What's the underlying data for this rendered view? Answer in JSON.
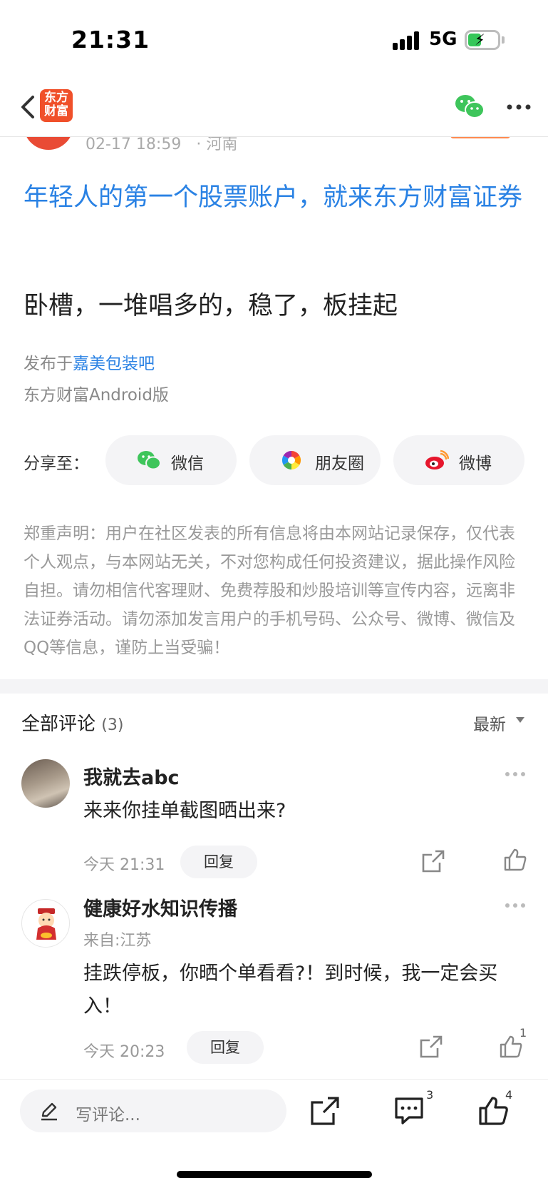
{
  "status_bar": {
    "time": "21:31",
    "network": "5G"
  },
  "nav": {
    "logo_line1": "东方",
    "logo_line2": "财富"
  },
  "post": {
    "meta_time": "02-17 18:59",
    "meta_location": "· 河南",
    "title": "年轻人的第一个股票账户，就来东方财富证券",
    "body": "卧槽，一堆唱多的，稳了，板挂起",
    "published_prefix": "发布于",
    "published_bar": "嘉美包装吧",
    "platform": "东方财富Android版"
  },
  "share": {
    "label": "分享至：",
    "buttons": [
      {
        "label": "微信",
        "icon": "wechat-icon"
      },
      {
        "label": "朋友圈",
        "icon": "moments-icon"
      },
      {
        "label": "微博",
        "icon": "weibo-icon"
      }
    ]
  },
  "disclaimer": "郑重声明：用户在社区发表的所有信息将由本网站记录保存，仅代表个人观点，与本网站无关，不对您构成任何投资建议，据此操作风险自担。请勿相信代客理财、免费荐股和炒股培训等宣传内容，远离非法证券活动。请勿添加发言用户的手机号码、公众号、微博、微信及QQ等信息，谨防上当受骗！",
  "comments": {
    "title": "全部评论",
    "count": "(3)",
    "sort": "最新",
    "items": [
      {
        "name": "我就去abc",
        "from": "",
        "text": "来来你挂单截图晒出来?",
        "time": "今天 21:31",
        "reply": "回复",
        "likes": ""
      },
      {
        "name": "健康好水知识传播",
        "from": "来自:江苏",
        "text": "挂跌停板，你晒个单看看?！到时候，我一定会买入！",
        "time": "今天 20:23",
        "reply": "回复",
        "likes": "1"
      }
    ]
  },
  "bottom_bar": {
    "placeholder": "写评论...",
    "comment_count": "3",
    "like_count": "4"
  }
}
